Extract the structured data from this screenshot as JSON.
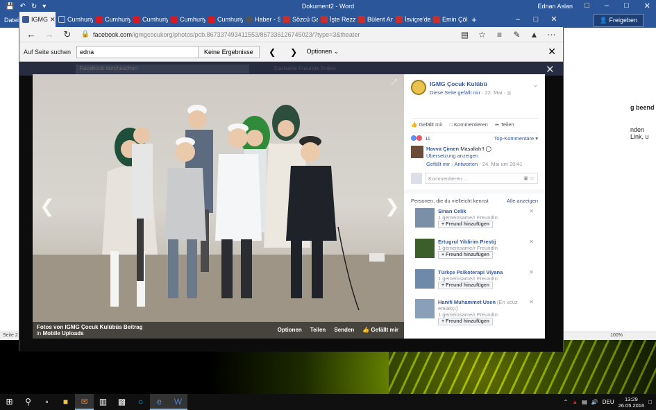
{
  "word": {
    "doc_title": "Dokument2 - Word",
    "user": "Ednan Aslan",
    "share_label": "Freigeben",
    "ribbon_file": "Datei",
    "right_pane_heading": "g beend",
    "right_pane_text": "nden Link, u",
    "status_page": "Seite 2",
    "zoom": "100%"
  },
  "edge": {
    "tabs": [
      {
        "label": "IGMG",
        "favicon": "facebook-icon",
        "active": true
      },
      {
        "label": "Cumhuriy",
        "favicon": "page-icon"
      },
      {
        "label": "Cumhuriy",
        "favicon": "cumhuriyet-icon"
      },
      {
        "label": "Cumhuriy",
        "favicon": "cumhuriyet-icon"
      },
      {
        "label": "Cumhuriy",
        "favicon": "cumhuriyet-icon"
      },
      {
        "label": "Cumhuriy",
        "favicon": "cumhuriyet-icon"
      },
      {
        "label": "Haber - S",
        "favicon": "haber-icon"
      },
      {
        "label": "Sözcü Ga",
        "favicon": "sozcu-icon"
      },
      {
        "label": "İşte Rezza",
        "favicon": "sozcu-icon"
      },
      {
        "label": "Bülent An",
        "favicon": "sozcu-icon"
      },
      {
        "label": "İsviçre'de",
        "favicon": "sozcu-icon"
      },
      {
        "label": "Emin Çöla",
        "favicon": "sozcu-icon"
      }
    ],
    "url_host": "facebook.com",
    "url_path": "/igmgcocukorg/photos/pcb.867337493411553/867336126745023/?type=3&theater",
    "find": {
      "label": "Auf Seite suchen",
      "value": "edna",
      "result": "Keine Ergebnisse",
      "options": "Optionen"
    }
  },
  "facebook": {
    "search_placeholder": "Facebook durchsuchen",
    "header_links": "Startseite   Freunde finden",
    "photo_caption_line1": "Fotos von IGMG Çocuk Kulübüs Beitrag",
    "photo_caption_line2_prefix": "in ",
    "photo_caption_line2_link": "Mobile Uploads",
    "photo_actions": [
      "Optionen",
      "Teilen",
      "Senden",
      "Gefällt mir"
    ],
    "page_name": "IGMG Çocuk Kulübü",
    "post_sub_link": "Diese Seite gefällt mir",
    "post_date": " · 22. Mai · ",
    "post_actions": [
      "Gefällt mir",
      "Kommentieren",
      "Teilen"
    ],
    "reaction_count": "11",
    "top_comments": "Top-Kommentare",
    "comment": {
      "author": "Havva Çimen",
      "text": " Masallah!!",
      "translate": "Übersetzung anzeigen",
      "like": "Gefällt mir",
      "reply": "Antworten",
      "date": " · 24. Mai um 20:41"
    },
    "comment_placeholder": "Kommentieren ...",
    "pymk_heading": "Personen, die du vielleicht kennst",
    "pymk_all": "Alle anzeigen",
    "people": [
      {
        "name": "Sinan Celik",
        "extra": "",
        "mutual": "1 gemeinsame/r FreundIn",
        "add": "Freund hinzufügen",
        "color": "#7b8fa6"
      },
      {
        "name": "Ertugrul Yildirim Prestij",
        "extra": "",
        "mutual": "1 gemeinsame/r FreundIn",
        "add": "Freund hinzufügen",
        "color": "#3b5e2b"
      },
      {
        "name": "Türkçe Psikoterapi Viyana",
        "extra": "",
        "mutual": "1 gemeinsame/r FreundIn",
        "add": "Freund hinzufügen",
        "color": "#6f8aa8"
      },
      {
        "name": "Hanifi Muhammet Usen",
        "extra": " (En ucuz emlakçı)",
        "mutual": "1 gemeinsame/r FreundIn",
        "add": "Freund hinzufügen",
        "color": "#8aa0b8"
      }
    ]
  },
  "taskbar": {
    "lang": "DEU",
    "time": "13:29",
    "date": "26.05.2016"
  }
}
